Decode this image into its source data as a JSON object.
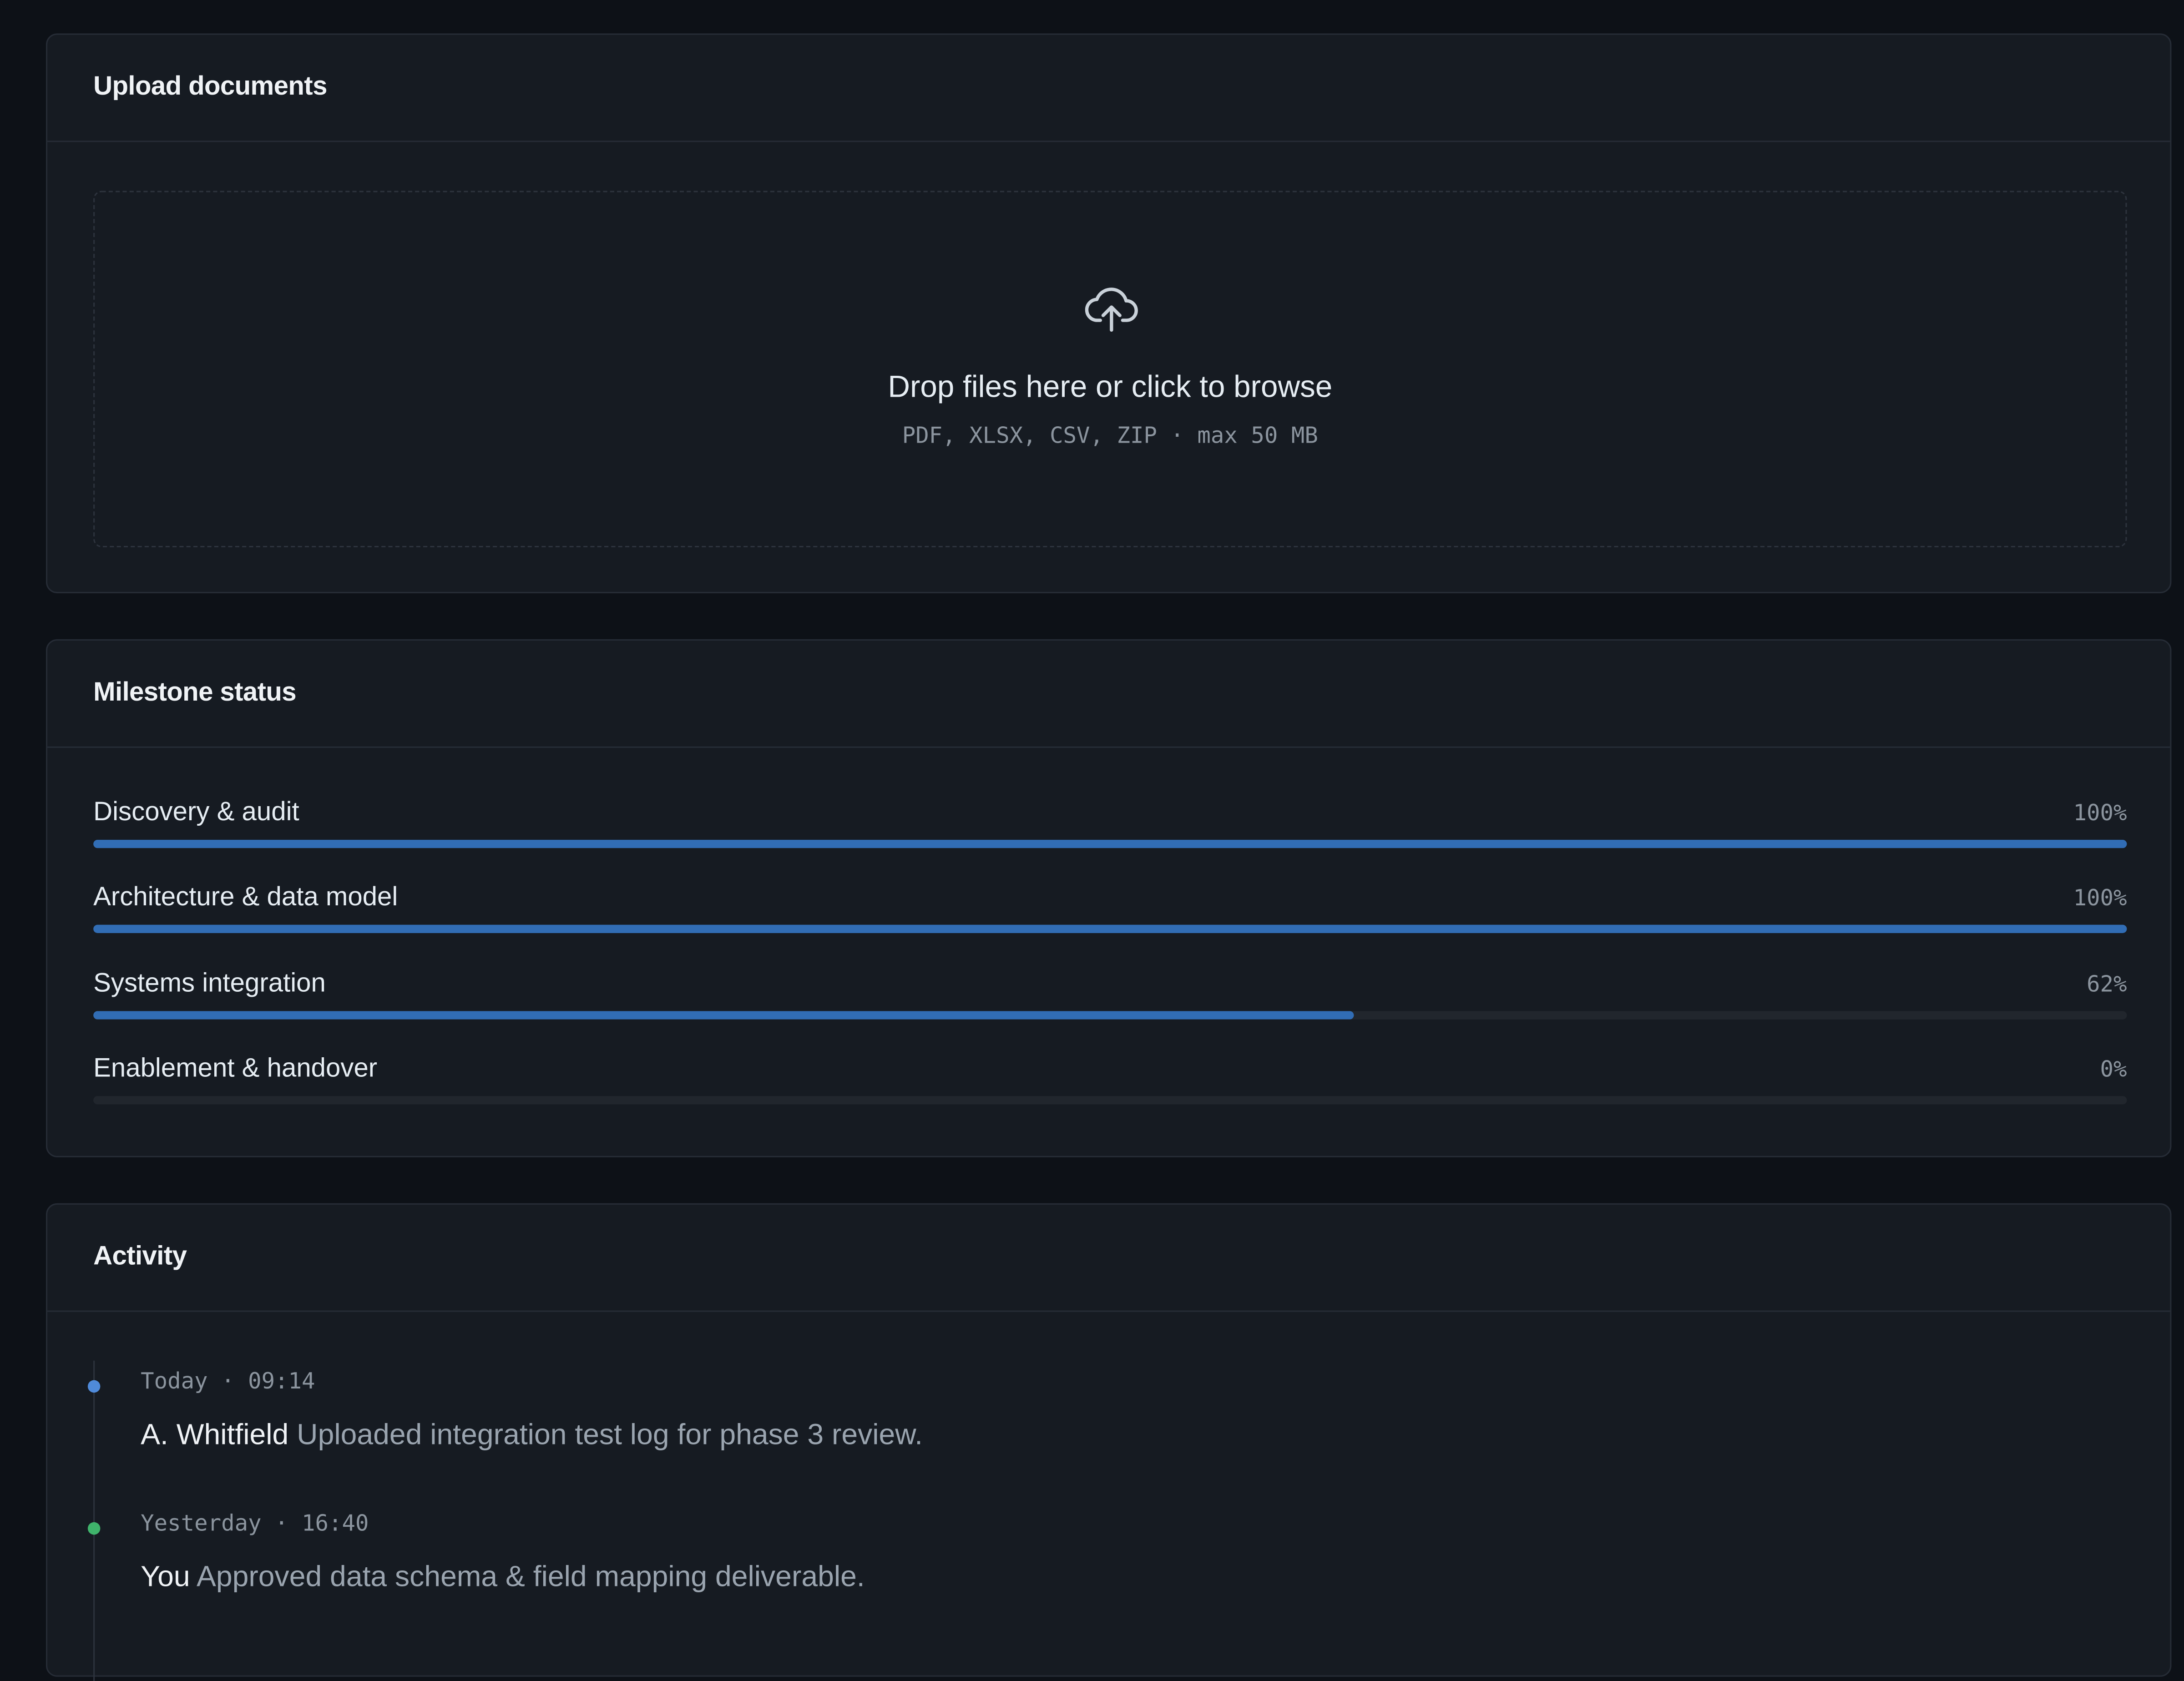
{
  "upload": {
    "title": "Upload documents",
    "drop_title": "Drop files here or click to browse",
    "drop_subtitle": "PDF, XLSX, CSV, ZIP · max 50 MB",
    "icon": "cloud-upload-icon"
  },
  "milestones": {
    "title": "Milestone status",
    "accent_color": "#316db5",
    "items": [
      {
        "label": "Discovery & audit",
        "percent_label": "100%",
        "progress": 100
      },
      {
        "label": "Architecture & data model",
        "percent_label": "100%",
        "progress": 100
      },
      {
        "label": "Systems integration",
        "percent_label": "62%",
        "progress": 62
      },
      {
        "label": "Enablement & handover",
        "percent_label": "0%",
        "progress": 0
      }
    ]
  },
  "activity": {
    "title": "Activity",
    "items": [
      {
        "time": "Today · 09:14",
        "actor": "A. Whitfield",
        "message": "Uploaded integration test log for phase 3 review.",
        "dot_color": "#4f8ad9"
      },
      {
        "time": "Yesterday · 16:40",
        "actor": "You",
        "message": "Approved data schema & field mapping deliverable.",
        "dot_color": "#3fb36b"
      }
    ]
  }
}
